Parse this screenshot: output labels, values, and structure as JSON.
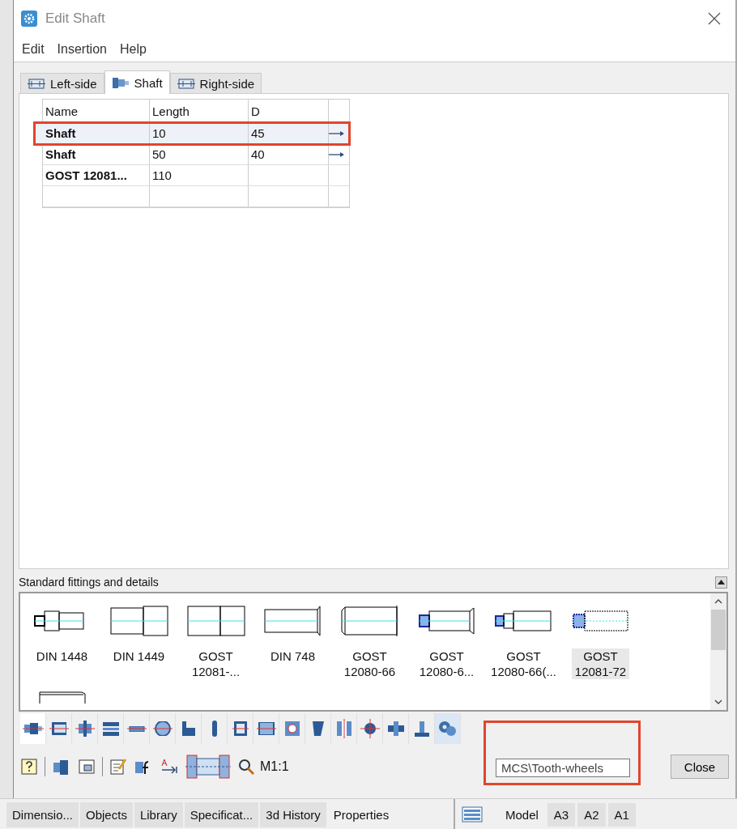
{
  "window": {
    "title": "Edit Shaft"
  },
  "menu": [
    "Edit",
    "Insertion",
    "Help"
  ],
  "tabs": [
    {
      "label": "Left-side",
      "selected": false
    },
    {
      "label": "Shaft",
      "selected": true
    },
    {
      "label": "Right-side",
      "selected": false
    }
  ],
  "table": {
    "columns": [
      "Name",
      "Length",
      "D"
    ],
    "rows": [
      {
        "cells": [
          "Shaft",
          "10",
          "45"
        ],
        "arrow": true,
        "highlighted": true
      },
      {
        "cells": [
          "Shaft",
          "50",
          "40"
        ],
        "arrow": true,
        "highlighted": false
      },
      {
        "cells": [
          "GOST 12081...",
          "110",
          ""
        ],
        "arrow": false,
        "highlighted": false
      },
      {
        "cells": [
          "",
          "",
          ""
        ],
        "arrow": false,
        "highlighted": false
      }
    ]
  },
  "fittings": {
    "title": "Standard fittings and details",
    "items": [
      {
        "lines": [
          "DIN 1448"
        ],
        "selected": false
      },
      {
        "lines": [
          "DIN 1449"
        ],
        "selected": false
      },
      {
        "lines": [
          "GOST",
          "12081-..."
        ],
        "selected": false
      },
      {
        "lines": [
          "DIN 748"
        ],
        "selected": false
      },
      {
        "lines": [
          "GOST",
          "12080-66"
        ],
        "selected": false
      },
      {
        "lines": [
          "GOST",
          "12080-6..."
        ],
        "selected": false
      },
      {
        "lines": [
          "GOST",
          "12080-66(..."
        ],
        "selected": false
      },
      {
        "lines": [
          "GOST",
          "12081-72"
        ],
        "selected": true
      }
    ]
  },
  "categories": [
    {
      "selected": true
    },
    {
      "selected": false
    },
    {
      "selected": false
    },
    {
      "selected": false
    },
    {
      "selected": false
    },
    {
      "selected": false
    },
    {
      "selected": false
    },
    {
      "selected": false
    },
    {
      "selected": false
    },
    {
      "selected": false
    },
    {
      "selected": false
    },
    {
      "selected": false
    },
    {
      "selected": false
    },
    {
      "selected": false
    },
    {
      "selected": false
    },
    {
      "selected": false
    },
    {
      "selected": false,
      "highlighted": true
    }
  ],
  "tooltip": "MCS\\Tooth-wheels",
  "toolbar": {
    "scale": "M1:1",
    "close": "Close"
  },
  "bottom_tabs": [
    {
      "label": "Dimensio...",
      "selected": false
    },
    {
      "label": "Objects",
      "selected": false
    },
    {
      "label": "Library",
      "selected": false
    },
    {
      "label": "Specificat...",
      "selected": false
    },
    {
      "label": "3d History",
      "selected": false
    },
    {
      "label": "Properties",
      "selected": true
    }
  ],
  "sheet_tabs": [
    {
      "label": "Model",
      "selected": true
    },
    {
      "label": "A3",
      "selected": false
    },
    {
      "label": "A2",
      "selected": false
    },
    {
      "label": "A1",
      "selected": false
    }
  ]
}
